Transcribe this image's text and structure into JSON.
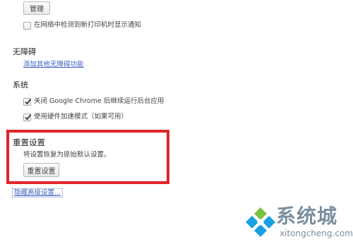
{
  "printers": {
    "manage_button": "管理",
    "notify_new_printers_label": "在网络中检测到新打印机时显示通知",
    "notify_new_printers_checked": false
  },
  "accessibility": {
    "title": "无障碍",
    "add_features_link": "添加其他无障碍功能"
  },
  "system": {
    "title": "系统",
    "background_apps_label": "关闭 Google Chrome 后继续运行后台应用",
    "background_apps_checked": true,
    "hardware_acceleration_label": "使用硬件加速模式（如果可用）",
    "hardware_acceleration_checked": true
  },
  "reset": {
    "title": "重置设置",
    "description": "将设置恢复为原始默认设置。",
    "button": "重置设置",
    "highlight_color": "#e2242b"
  },
  "footer": {
    "hide_advanced_link": "隐藏高级设置..."
  },
  "watermark": {
    "name": "系统城",
    "domain": "xitongcheng.com",
    "logo_colors": [
      "#1aa0e0",
      "#7cc242"
    ]
  }
}
